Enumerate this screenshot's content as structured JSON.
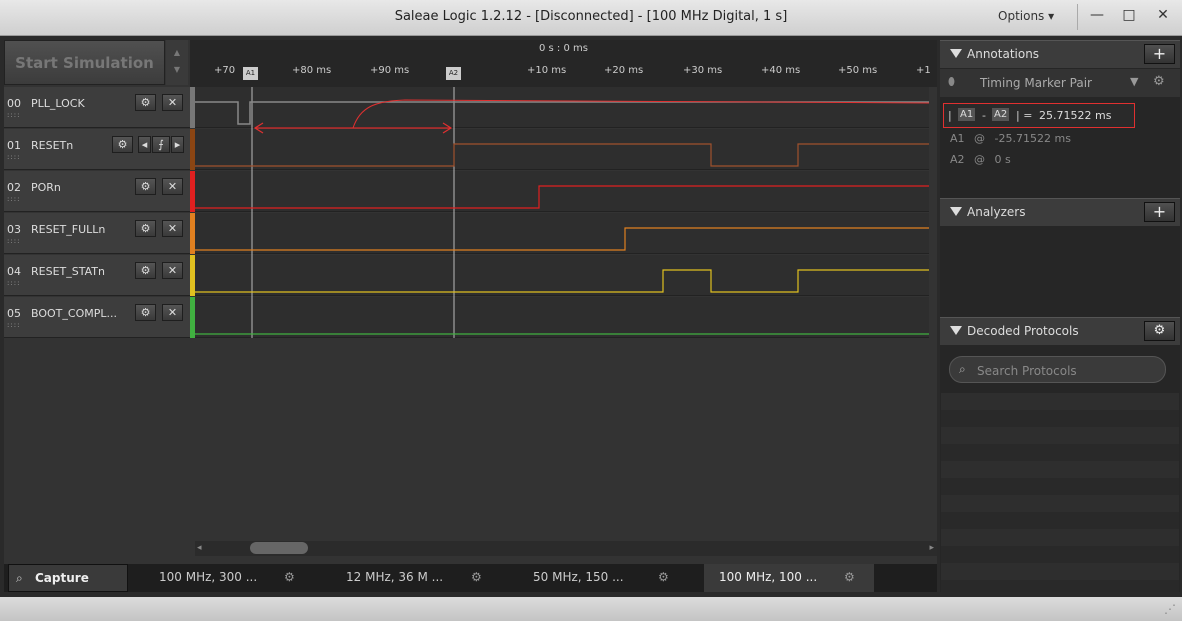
{
  "window": {
    "title": "Saleae Logic 1.2.12 - [Disconnected] - [100 MHz Digital, 1 s]",
    "options_label": "Options ▾",
    "minimize": "—",
    "maximize": "□",
    "close": "✕"
  },
  "toolbar": {
    "start_simulation": "Start Simulation"
  },
  "ruler": {
    "title": "0 s : 0 ms",
    "labels": [
      "+70",
      "+80 ms",
      "+90 ms",
      "+10 ms",
      "+20 ms",
      "+30 ms",
      "+40 ms",
      "+50 ms",
      "+1"
    ],
    "marker_a1": "A1",
    "marker_a2": "A2"
  },
  "channels": [
    {
      "num": "00",
      "name": "PLL_LOCK",
      "color": "#777777"
    },
    {
      "num": "01",
      "name": "RESETn",
      "color": "#8b4513"
    },
    {
      "num": "02",
      "name": "PORn",
      "color": "#e02020"
    },
    {
      "num": "03",
      "name": "RESET_FULLn",
      "color": "#e08020"
    },
    {
      "num": "04",
      "name": "RESET_STATn",
      "color": "#e0c020"
    },
    {
      "num": "05",
      "name": "BOOT_COMPL...",
      "color": "#40b040"
    }
  ],
  "channel_buttons": {
    "settings": "⚙",
    "close": "✕",
    "prev": "◂",
    "edge": "⨍",
    "next": "▸"
  },
  "tabs": [
    {
      "label": "Capture"
    },
    {
      "label": "100 MHz, 300 ..."
    },
    {
      "label": "12 MHz, 36 M ..."
    },
    {
      "label": "50 MHz, 150 ..."
    },
    {
      "label": "100 MHz, 100 ..."
    }
  ],
  "annotations": {
    "title": "Annotations",
    "add": "+",
    "marker_pair": "Timing Marker Pair",
    "measure_a1": "A1",
    "measure_a2": "A2",
    "measure_value": "25.71522 ms",
    "a1_label": "A1",
    "a1_value": "-25.71522 ms",
    "a2_label": "A2",
    "a2_value": "0 s"
  },
  "analyzers": {
    "title": "Analyzers",
    "add": "+"
  },
  "decoded": {
    "title": "Decoded Protocols",
    "search_placeholder": "Search Protocols"
  }
}
